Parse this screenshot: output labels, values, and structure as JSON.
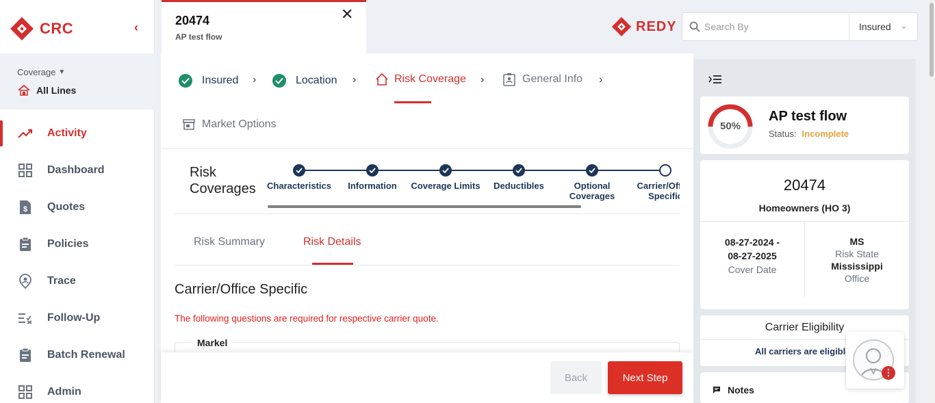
{
  "brand": {
    "name": "CRC",
    "color": "#d32f2f"
  },
  "sidebar": {
    "coverage_label": "Coverage",
    "coverage_value": "All Lines",
    "items": [
      {
        "label": "Activity",
        "icon": "trending-up-icon",
        "active": true
      },
      {
        "label": "Dashboard",
        "icon": "grid-icon"
      },
      {
        "label": "Quotes",
        "icon": "quote-doc-icon"
      },
      {
        "label": "Policies",
        "icon": "clipboard-icon"
      },
      {
        "label": "Trace",
        "icon": "location-user-icon"
      },
      {
        "label": "Follow-Up",
        "icon": "checklist-icon"
      },
      {
        "label": "Batch Renewal",
        "icon": "clipboard-icon"
      },
      {
        "label": "Admin",
        "icon": "grid-icon"
      }
    ]
  },
  "file_tab": {
    "number": "20474",
    "subtitle": "AP test flow"
  },
  "header": {
    "product_name": "REDY",
    "search_placeholder": "Search By",
    "search_scope": "Insured"
  },
  "steps": [
    {
      "label": "Insured",
      "state": "done"
    },
    {
      "label": "Location",
      "state": "done"
    },
    {
      "label": "Risk Coverage",
      "state": "current"
    },
    {
      "label": "General Info",
      "state": "pending"
    },
    {
      "label": "Market Options",
      "state": "pending"
    }
  ],
  "risk_coverages": {
    "title": "Risk Coverages",
    "substeps": [
      "Characteristics",
      "Information",
      "Coverage Limits",
      "Deductibles",
      "Optional Coverages",
      "Carrier/Office Specific"
    ]
  },
  "detail_tabs": {
    "summary": "Risk Summary",
    "details": "Risk Details"
  },
  "section": {
    "title": "Carrier/Office Specific",
    "warning": "The following questions are required for respective carrier quote.",
    "group_legend": "Markel"
  },
  "footer": {
    "back_label": "Back",
    "next_label": "Next Step"
  },
  "summary": {
    "progress_text": "50%",
    "progress_fraction": 0.5,
    "name": "AP test flow",
    "status_label": "Status:",
    "status_value": "Incomplete",
    "number": "20474",
    "policy_type": "Homeowners (HO 3)",
    "date_start": "08-27-2024 -",
    "date_end": "08-27-2025",
    "date_label": "Cover Date",
    "state_code": "MS",
    "state_label": "Risk State",
    "office": "Mississippi",
    "office_label": "Office",
    "eligibility_title": "Carrier Eligibility",
    "eligibility_msg": "All carriers are eligible",
    "notes_title": "Notes"
  }
}
